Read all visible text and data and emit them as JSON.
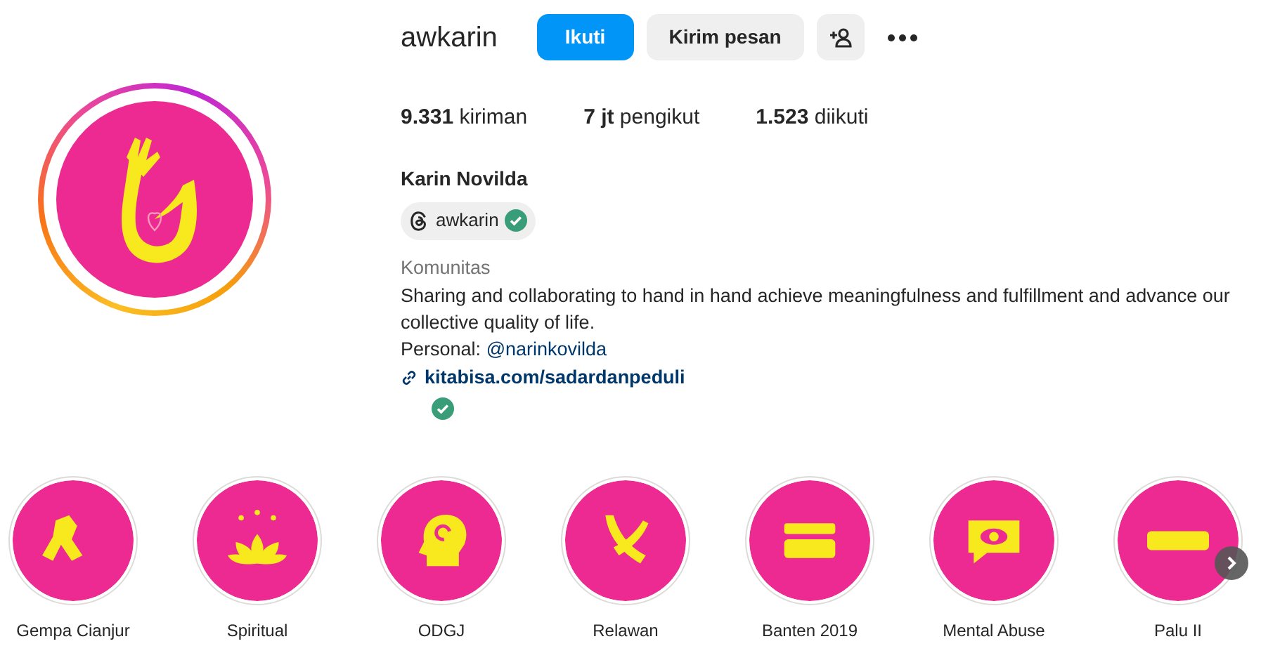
{
  "profile": {
    "username": "awkarin",
    "follow_button": "Ikuti",
    "message_button": "Kirim pesan",
    "has_story": true
  },
  "stats": [
    {
      "count": "9.331",
      "label": "kiriman"
    },
    {
      "count": "7 jt",
      "label": "pengikut"
    },
    {
      "count": "1.523",
      "label": "diikuti"
    }
  ],
  "full_name": "Karin Novilda",
  "threads_badge": {
    "handle": "awkarin",
    "verified": true
  },
  "category": "Komunitas",
  "bio": "Sharing and collaborating to hand in hand achieve meaningfulness and fulfillment and advance our collective quality of life.",
  "personal": {
    "label": "Personal:",
    "handle": "@narinkovilda"
  },
  "link": {
    "text": "kitabisa.com/sadardanpeduli",
    "verified": true
  },
  "highlights": [
    {
      "label": "Gempa Cianjur"
    },
    {
      "label": "Spiritual"
    },
    {
      "label": "ODGJ"
    },
    {
      "label": "Relawan"
    },
    {
      "label": "Banten 2019"
    },
    {
      "label": "Mental Abuse"
    },
    {
      "label": "Palu II"
    }
  ]
}
